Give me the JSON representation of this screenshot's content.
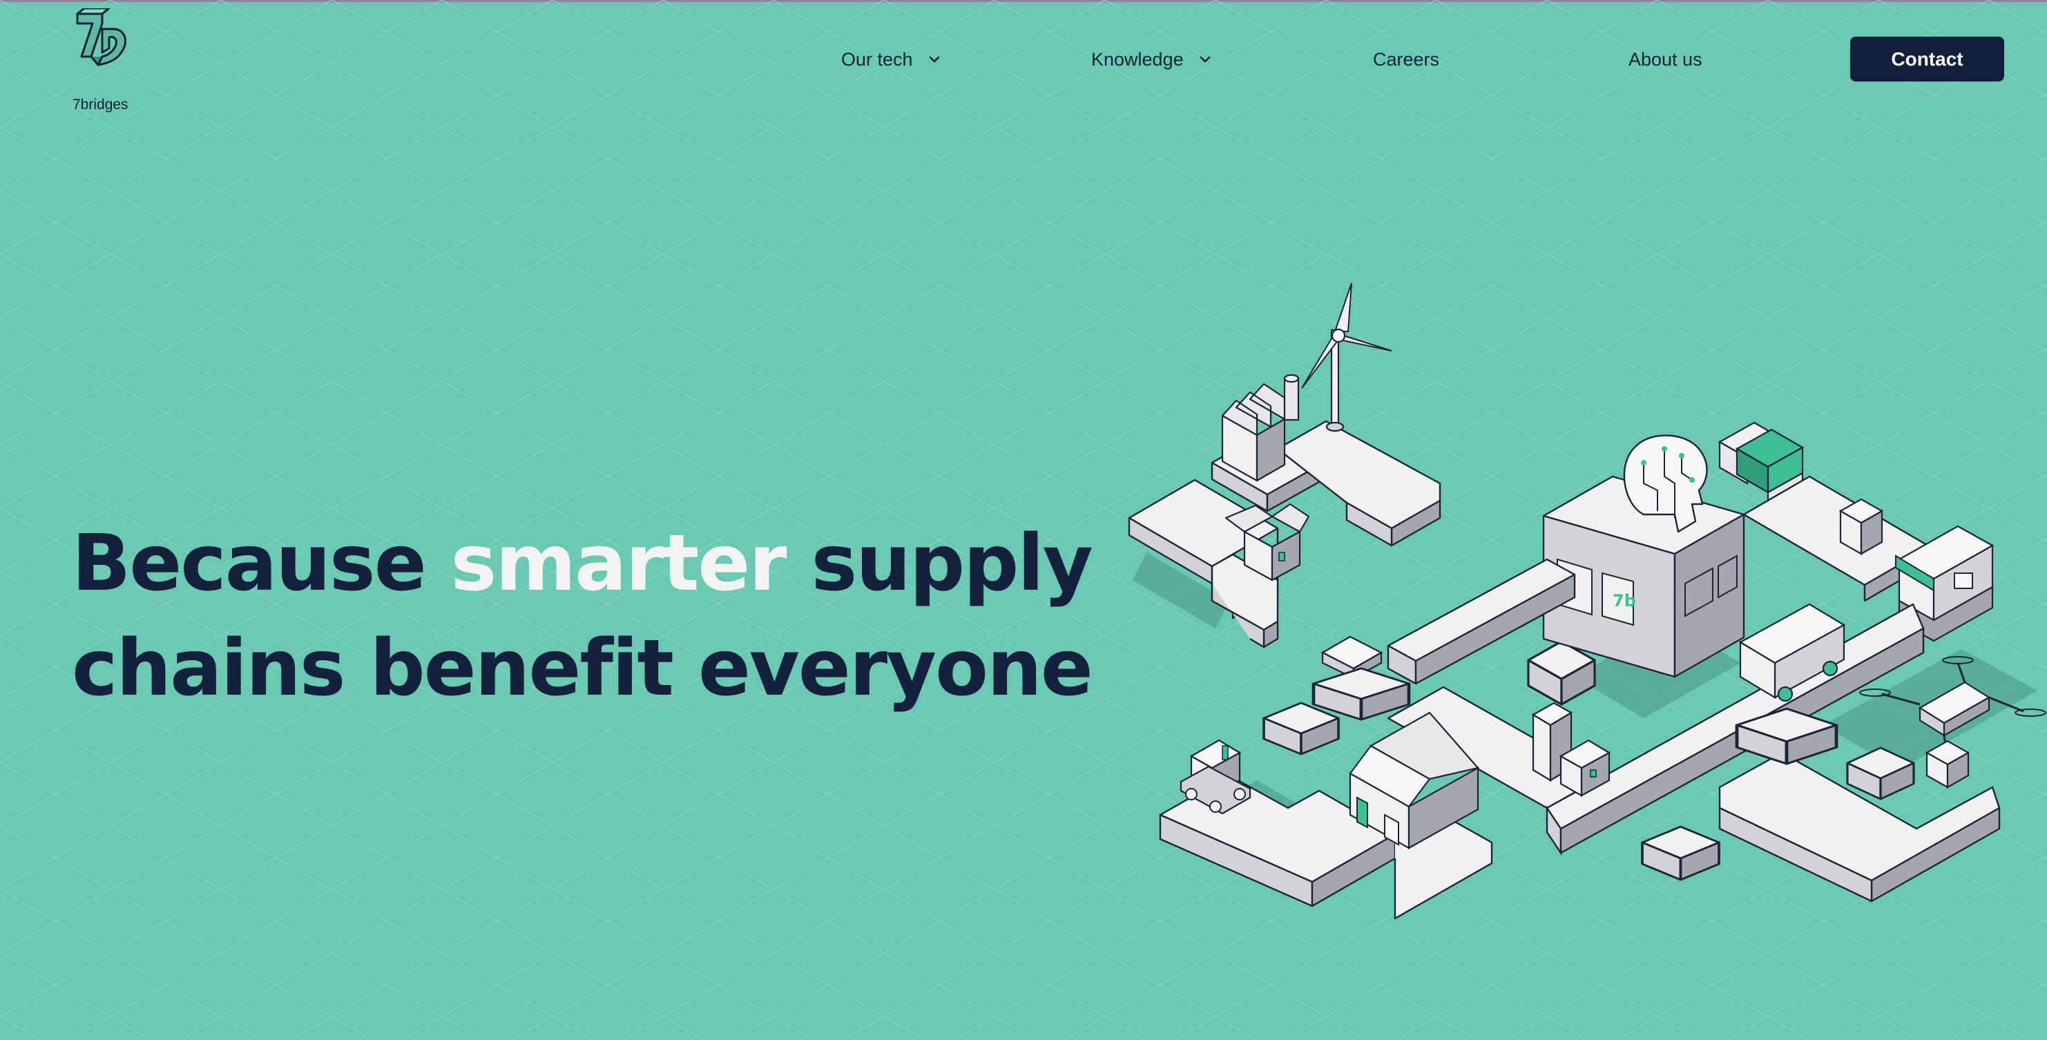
{
  "header": {
    "logo_text": "7bridges",
    "nav": [
      {
        "label": "Our tech",
        "has_dropdown": true,
        "icon": "chevron-down-icon"
      },
      {
        "label": "Knowledge",
        "has_dropdown": true,
        "icon": "chevron-down-icon"
      },
      {
        "label": "Careers",
        "has_dropdown": false
      },
      {
        "label": "About us",
        "has_dropdown": false
      }
    ],
    "contact_label": "Contact"
  },
  "hero": {
    "line1_before": "Because ",
    "line1_highlight": "smarter",
    "line1_after": " supply",
    "line2": "chains benefit everyone"
  },
  "illustration": {
    "icons": [
      "wind-turbine-icon",
      "factory-icon",
      "brain-icon",
      "shipping-container-icon",
      "truck-icon",
      "drone-icon",
      "warehouse-icon",
      "storefront-icon",
      "robot-icon",
      "box-icon"
    ]
  },
  "colors": {
    "background": "#6cc9b1",
    "navy": "#131f3a",
    "highlight": "#f2f4f1",
    "accent": "#3fbf95"
  }
}
